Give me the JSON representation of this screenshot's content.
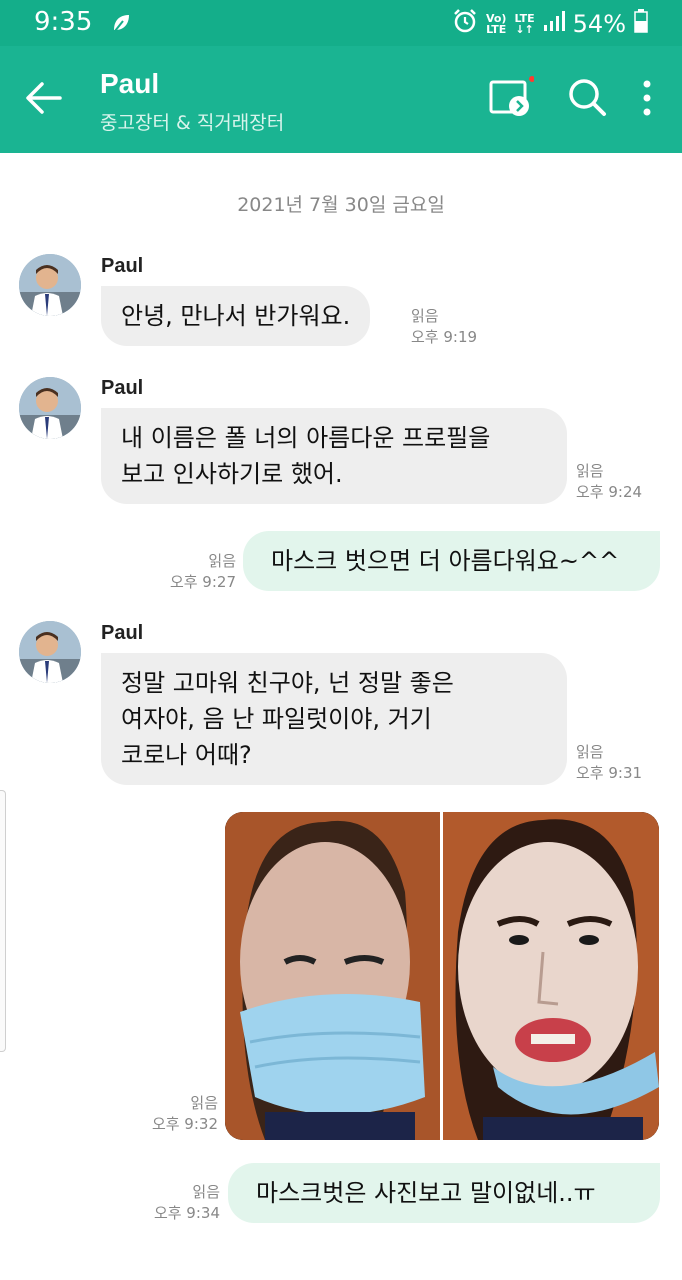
{
  "status": {
    "time": "9:35",
    "volte_top": "Vo)",
    "volte_bottom": "LTE",
    "lte_top": "LTE",
    "lte_bottom": "↓↑",
    "battery": "54%"
  },
  "header": {
    "title": "Paul",
    "subtitle": "중고장터 & 직거래장터"
  },
  "colors": {
    "header_bg": "#1ab492",
    "status_bg": "#14ae8a",
    "incoming_bubble": "#eeeeee",
    "outgoing_bubble": "#e2f5ec",
    "notification_dot": "#ff3b30"
  },
  "icons": {
    "back": "arrow-left-icon",
    "share_screen": "cast-screen-icon",
    "search": "search-icon",
    "more": "more-vertical-icon"
  },
  "date_separator": "2021년 7월 30일 금요일",
  "messages": [
    {
      "direction": "in",
      "sender": "Paul",
      "lines": [
        "안녕, 만나서 반가워요."
      ],
      "read": "읽음",
      "time": "오후 9:19"
    },
    {
      "direction": "in",
      "sender": "Paul",
      "lines": [
        "내 이름은 폴 너의 아름다운 프로필을",
        "보고 인사하기로 했어."
      ],
      "read": "읽음",
      "time": "오후 9:24"
    },
    {
      "direction": "out",
      "lines": [
        "마스크 벗으면 더 아름다워요~^^"
      ],
      "read": "읽음",
      "time": "오후 9:27"
    },
    {
      "direction": "in",
      "sender": "Paul",
      "lines": [
        "정말 고마워 친구야, 넌 정말 좋은",
        "여자야, 음 난 파일럿이야, 거기",
        "코로나 어때?"
      ],
      "read": "읽음",
      "time": "오후 9:31"
    },
    {
      "direction": "out",
      "type": "image",
      "read": "읽음",
      "time": "오후 9:32"
    },
    {
      "direction": "out",
      "lines": [
        "마스크벗은 사진보고 말이없네..ㅠ"
      ],
      "read": "읽음",
      "time": "오후 9:34"
    }
  ]
}
